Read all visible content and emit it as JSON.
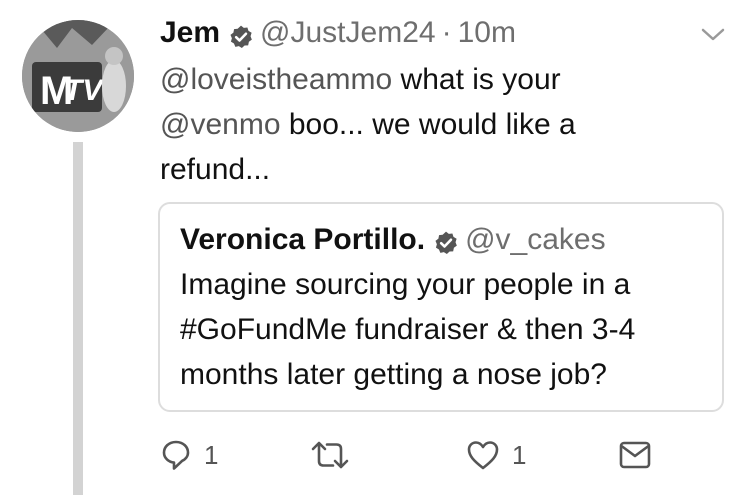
{
  "tweet": {
    "author_name": "Jem",
    "handle": "@JustJem24",
    "separator": "·",
    "time": "10m",
    "mention": "@loveistheammo",
    "text_part1": " what is your",
    "mention2": "@venmo",
    "text_part2": " boo... we would like a refund..."
  },
  "avatar": {
    "logo_text": "TV",
    "logo_m": "M"
  },
  "quoted_tweet": {
    "author_name": "Veronica Portillo.",
    "handle": "@v_cakes",
    "text": "Imagine sourcing your people in a #GoFundMe fundraiser & then 3-4 months later getting a nose job?"
  },
  "actions": {
    "reply_count": "1",
    "like_count": "1"
  },
  "icons": [
    "verified-badge-icon",
    "chevron-down-icon",
    "reply-icon",
    "retweet-icon",
    "like-icon",
    "message-icon"
  ],
  "colors": {
    "text": "#111111",
    "secondary": "#6e6e6e",
    "border": "#dddddd",
    "thread_line": "#d3d3d3"
  }
}
